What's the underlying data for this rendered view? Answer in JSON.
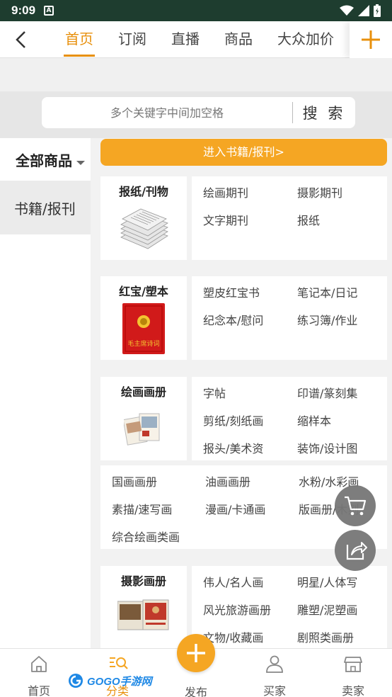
{
  "status_bar": {
    "time": "9:09",
    "notification_letter": "A"
  },
  "top_nav": {
    "tabs": [
      "首页",
      "订阅",
      "直播",
      "商品",
      "大众加价"
    ],
    "active_tab": 0
  },
  "search": {
    "placeholder": "多个关键字中间加空格",
    "button": "搜 索"
  },
  "sidebar": {
    "all_label": "全部商品",
    "books_label": "书籍/报刊"
  },
  "content": {
    "enter_label": "进入书籍/报刊>",
    "categories": [
      {
        "title": "报纸/刊物",
        "items": [
          "绘画期刊",
          "摄影期刊",
          "文字期刊",
          "报纸"
        ]
      },
      {
        "title": "红宝/塑本",
        "items": [
          "塑皮红宝书",
          "笔记本/日记",
          "纪念本/慰问",
          "练习簿/作业"
        ]
      },
      {
        "title": "绘画画册",
        "items": [
          "字帖",
          "印谱/篆刻集",
          "剪纸/刻纸画",
          "缩样本",
          "报头/美术资",
          "装饰/设计图"
        ],
        "extra": [
          "国画画册",
          "油画画册",
          "水粉/水彩画",
          "素描/速写画",
          "漫画/卡通画",
          "版画册/木刻",
          "综合绘画类画"
        ]
      },
      {
        "title": "摄影画册",
        "items": [
          "伟人/名人画",
          "明星/人体写",
          "风光旅游画册",
          "雕塑/泥塑画",
          "文物/收藏画",
          "剧照类画册"
        ]
      }
    ],
    "redbook_cover_text": "毛主席诗词"
  },
  "bottom_nav": {
    "items": [
      "首页",
      "分类",
      "发布",
      "买家",
      "卖家"
    ]
  },
  "watermark": {
    "text": "GOGO手游网"
  },
  "colors": {
    "accent": "#e8900c",
    "button": "#f5a623",
    "status_bar": "#1e3d2f"
  }
}
